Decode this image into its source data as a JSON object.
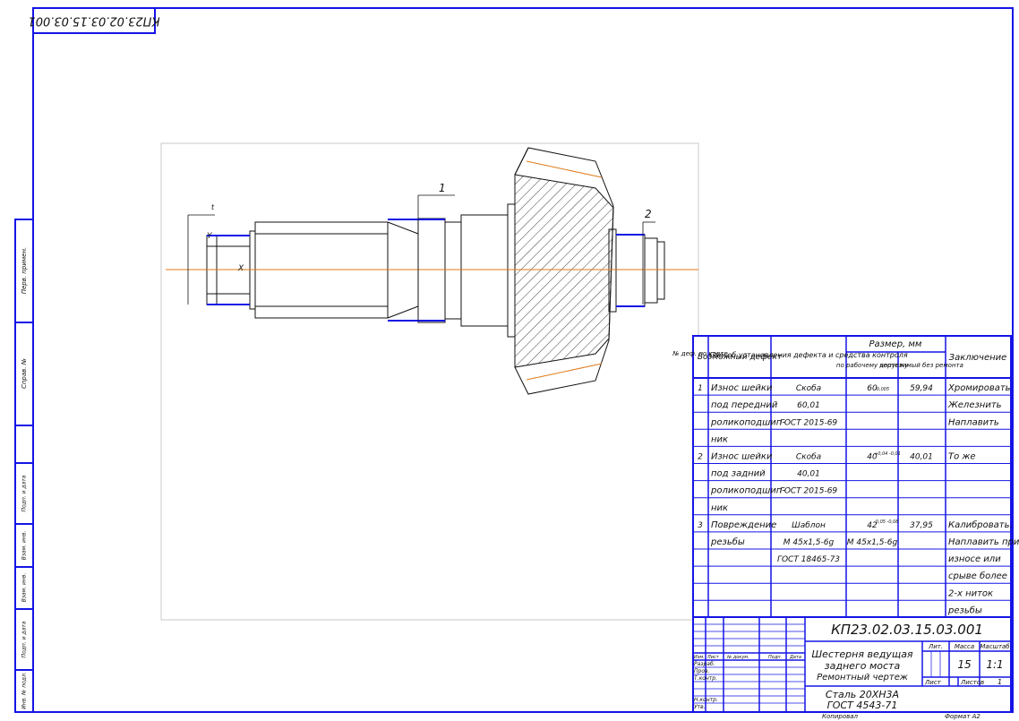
{
  "header_code": "КП23.02.03.15.03.001",
  "side_labels": [
    "Взам. инв.",
    "Подп. и дата",
    "Инв. № подл.",
    "Справ. №",
    "Перв. примен."
  ],
  "callouts": [
    "1",
    "2",
    "t"
  ],
  "axis_labels": [
    "Y",
    "X"
  ],
  "table": {
    "headers": {
      "num": "№ деф. по карте",
      "defect": "Возможный дефект",
      "method": "Способ установления дефекта и средства контроля",
      "size": "Размер, мм",
      "size_drawing": "по рабочему чертежу",
      "size_allowed": "допустимый без ремонта",
      "conclusion": "Заключение"
    },
    "rows": [
      [
        "1",
        "Износ шейки",
        "Скоба",
        "60",
        "59,94",
        "Хромировать"
      ],
      [
        "",
        "под передний",
        "60,01",
        "",
        "",
        "Железнить"
      ],
      [
        "",
        "роликоподшип-",
        "ГОСТ 2015-69",
        "",
        "",
        "Наплавить"
      ],
      [
        "",
        "ник",
        "",
        "",
        "",
        ""
      ],
      [
        "2",
        "Износ шейки",
        "Скоба",
        "40",
        "40,01",
        "То же"
      ],
      [
        "",
        "под задний",
        "40,01",
        "",
        "",
        ""
      ],
      [
        "",
        "роликоподшип-",
        "ГОСТ 2015-69",
        "",
        "",
        ""
      ],
      [
        "",
        "ник",
        "",
        "",
        "",
        ""
      ],
      [
        "3",
        "Повреждение",
        "Шаблон",
        "42",
        "37,95",
        "Калибровать."
      ],
      [
        "",
        "резьбы",
        "М 45х1,5-6g",
        "М 45х1,5-6g",
        "",
        "Наплавить при"
      ],
      [
        "",
        "",
        "ГОСТ 18465-73",
        "",
        "",
        "износе или"
      ],
      [
        "",
        "",
        "",
        "",
        "",
        "срыве более"
      ],
      [
        "",
        "",
        "",
        "",
        "",
        "2-х ниток"
      ],
      [
        "",
        "",
        "",
        "",
        "",
        "резьбы"
      ]
    ],
    "tolerances": [
      "-0,005",
      "+0,04 -0,01",
      "-0,05 -0,08"
    ]
  },
  "title_block": {
    "doc_code": "КП23.02.03.15.03.001",
    "part_name_1": "Шестерня ведущая",
    "part_name_2": "заднего моста",
    "part_name_3": "Ремонтный чертеж",
    "material_1": "Сталь 20ХН3А",
    "material_2": "ГОСТ 4543-71",
    "col_lit": "Лит.",
    "col_mass": "Масса",
    "col_scale": "Масштаб",
    "mass": "15",
    "scale": "1:1",
    "sheet_label": "Лист",
    "sheets_label": "Листов",
    "sheets": "1",
    "roles": [
      "Разраб.",
      "Пров.",
      "Т.контр.",
      "",
      "Н.контр.",
      "Утв."
    ],
    "role_headers": [
      "Изм.",
      "Лист",
      "№ докум.",
      "Подп.",
      "Дата"
    ],
    "copied": "Копировал",
    "format": "Формат A2"
  },
  "colors": {
    "frame": "#1414e6",
    "lines": "#111111",
    "axis": "#e07a1a",
    "highlight": "#1414e6"
  }
}
